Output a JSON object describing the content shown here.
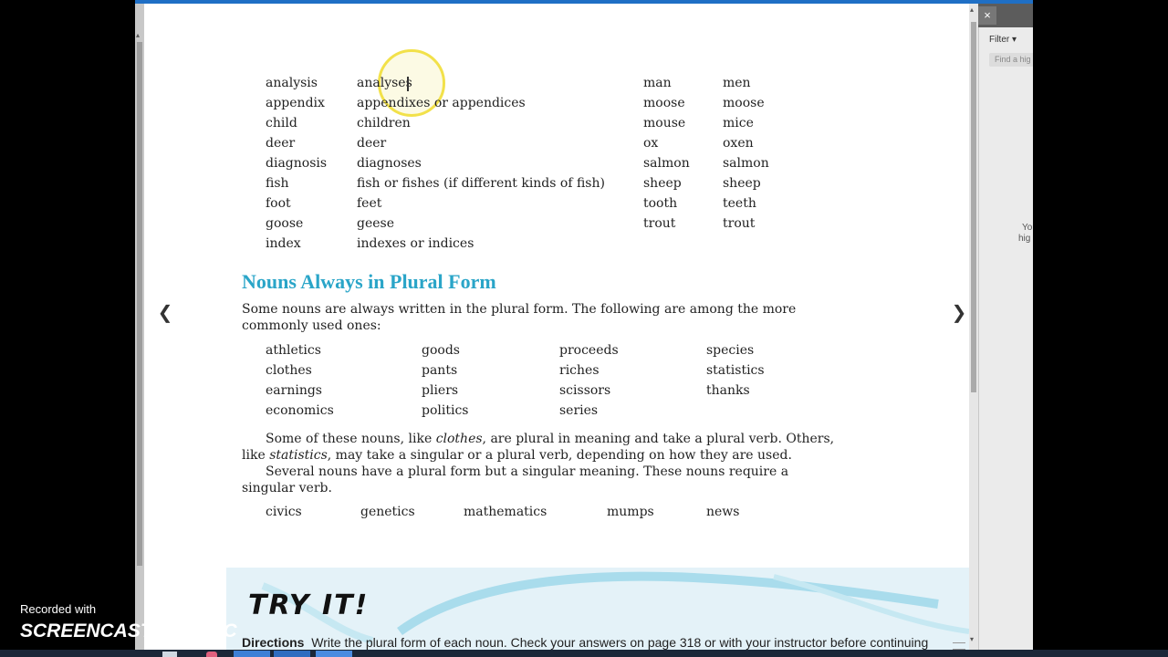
{
  "side_panel": {
    "close_label": "×",
    "filter_label": "Filter",
    "search_placeholder": "Find a hig",
    "truncated_text_1": "Yo",
    "truncated_text_2": "hig"
  },
  "irregular_plurals_left": [
    [
      "analysis",
      "analyses"
    ],
    [
      "appendix",
      "appendixes or appendices"
    ],
    [
      "child",
      "children"
    ],
    [
      "deer",
      "deer"
    ],
    [
      "diagnosis",
      "diagnoses"
    ],
    [
      "fish",
      "fish or fishes (if different kinds of fish)"
    ],
    [
      "foot",
      "feet"
    ],
    [
      "goose",
      "geese"
    ],
    [
      "index",
      "indexes or indices"
    ]
  ],
  "irregular_plurals_right": [
    [
      "man",
      "men"
    ],
    [
      "moose",
      "moose"
    ],
    [
      "mouse",
      "mice"
    ],
    [
      "ox",
      "oxen"
    ],
    [
      "salmon",
      "salmon"
    ],
    [
      "sheep",
      "sheep"
    ],
    [
      "tooth",
      "teeth"
    ],
    [
      "trout",
      "trout"
    ]
  ],
  "section": {
    "title": "Nouns Always in Plural Form",
    "intro_line1": "Some nouns are always written in the plural form. The following are among the more",
    "intro_line2": "commonly used ones:",
    "plural_columns": [
      [
        "athletics",
        "clothes",
        "earnings",
        "economics"
      ],
      [
        "goods",
        "pants",
        "pliers",
        "politics"
      ],
      [
        "proceeds",
        "riches",
        "scissors",
        "series"
      ],
      [
        "species",
        "statistics",
        "thanks"
      ]
    ],
    "para1_line1_a": "Some of these nouns, like ",
    "para1_line1_em": "clothes",
    "para1_line1_b": ", are plural in meaning and take a plural verb. Others,",
    "para1_line2_a": "like ",
    "para1_line2_em": "statistics",
    "para1_line2_b": ", may take a singular or a plural verb, depending on how they are used.",
    "para2_line1": "Several nouns have a plural form but a singular meaning. These nouns require a",
    "para2_line2": "singular verb.",
    "singular_meaning_nouns": [
      "civics",
      "genetics",
      "mathematics",
      "mumps",
      "news"
    ]
  },
  "try_it": {
    "title": "TRY IT!",
    "directions_label": "Directions",
    "directions_text": "Write the plural form of each noun. Check your answers on page 318 or with your instructor before continuing"
  },
  "watermark": {
    "recorded_with": "Recorded with",
    "brand_a": "SCREENCAST",
    "brand_b": "MATIC"
  },
  "colors": {
    "heading": "#2aa5c8",
    "highlight": "#f2e14a",
    "tryit_bg": "#e4f2f8",
    "top_accent": "#1f6fc5"
  }
}
